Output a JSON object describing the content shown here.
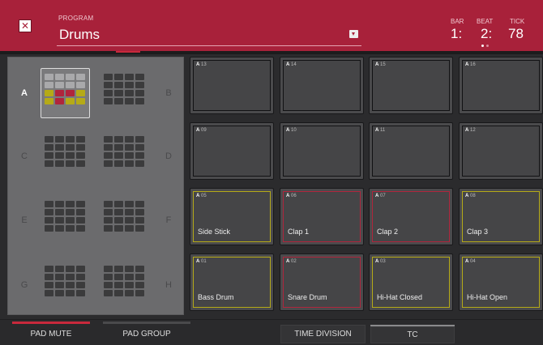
{
  "header": {
    "close_icon": "close-x-icon",
    "program_label": "PROGRAM",
    "program_name": "Drums",
    "dropdown_icon": "chevron-down-icon",
    "bar_label": "BAR",
    "bar_value": "1:",
    "beat_label": "BEAT",
    "beat_value": "2:",
    "tick_label": "TICK",
    "tick_value": "78",
    "accent_color": "#a8213a"
  },
  "banks": [
    {
      "letter": "A",
      "active": true
    },
    {
      "letter": "B",
      "active": false
    },
    {
      "letter": "C",
      "active": false
    },
    {
      "letter": "D",
      "active": false
    },
    {
      "letter": "E",
      "active": false
    },
    {
      "letter": "F",
      "active": false
    },
    {
      "letter": "G",
      "active": false
    },
    {
      "letter": "H",
      "active": false
    }
  ],
  "pads": [
    {
      "bank": "A",
      "num": "13",
      "name": "",
      "state": "empty"
    },
    {
      "bank": "A",
      "num": "14",
      "name": "",
      "state": "empty"
    },
    {
      "bank": "A",
      "num": "15",
      "name": "",
      "state": "empty"
    },
    {
      "bank": "A",
      "num": "16",
      "name": "",
      "state": "empty"
    },
    {
      "bank": "A",
      "num": "09",
      "name": "",
      "state": "empty"
    },
    {
      "bank": "A",
      "num": "10",
      "name": "",
      "state": "empty"
    },
    {
      "bank": "A",
      "num": "11",
      "name": "",
      "state": "empty"
    },
    {
      "bank": "A",
      "num": "12",
      "name": "",
      "state": "empty"
    },
    {
      "bank": "A",
      "num": "05",
      "name": "Side Stick",
      "state": "yellow"
    },
    {
      "bank": "A",
      "num": "06",
      "name": "Clap 1",
      "state": "red"
    },
    {
      "bank": "A",
      "num": "07",
      "name": "Clap 2",
      "state": "red"
    },
    {
      "bank": "A",
      "num": "08",
      "name": "Clap 3",
      "state": "yellow"
    },
    {
      "bank": "A",
      "num": "01",
      "name": "Bass Drum",
      "state": "yellow"
    },
    {
      "bank": "A",
      "num": "02",
      "name": "Snare Drum",
      "state": "red"
    },
    {
      "bank": "A",
      "num": "03",
      "name": "Hi-Hat Closed",
      "state": "yellow"
    },
    {
      "bank": "A",
      "num": "04",
      "name": "Hi-Hat Open",
      "state": "yellow"
    }
  ],
  "colors": {
    "yellow": "#b5aa17",
    "red": "#b0253c",
    "mini_light": "#a9a9ab",
    "mini_dark": "#3b3b3c"
  },
  "footer": {
    "pad_mute": "PAD MUTE",
    "pad_group": "PAD GROUP",
    "time_division": "TIME DIVISION",
    "tc": "TC"
  }
}
